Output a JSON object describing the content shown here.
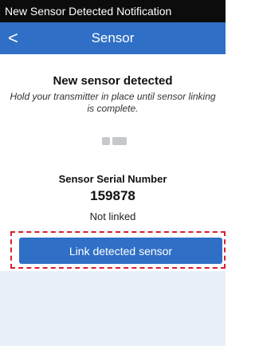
{
  "window": {
    "caption": "New Sensor Detected Notification"
  },
  "nav": {
    "title": "Sensor",
    "back_label": "<"
  },
  "main": {
    "headline": "New sensor detected",
    "instructions": "Hold your transmitter in place until sensor linking is complete.",
    "serial_label": "Sensor Serial Number",
    "serial_number": "159878",
    "status": "Not linked",
    "link_button_label": "Link detected sensor"
  },
  "colors": {
    "nav_background": "#2f6fc6",
    "button_background": "#2f6fc6",
    "highlight_border": "#d61f2b",
    "lower_panel": "#e9eff8"
  },
  "icons": [
    "back-chevron-icon",
    "sensor-indicator-icon"
  ]
}
